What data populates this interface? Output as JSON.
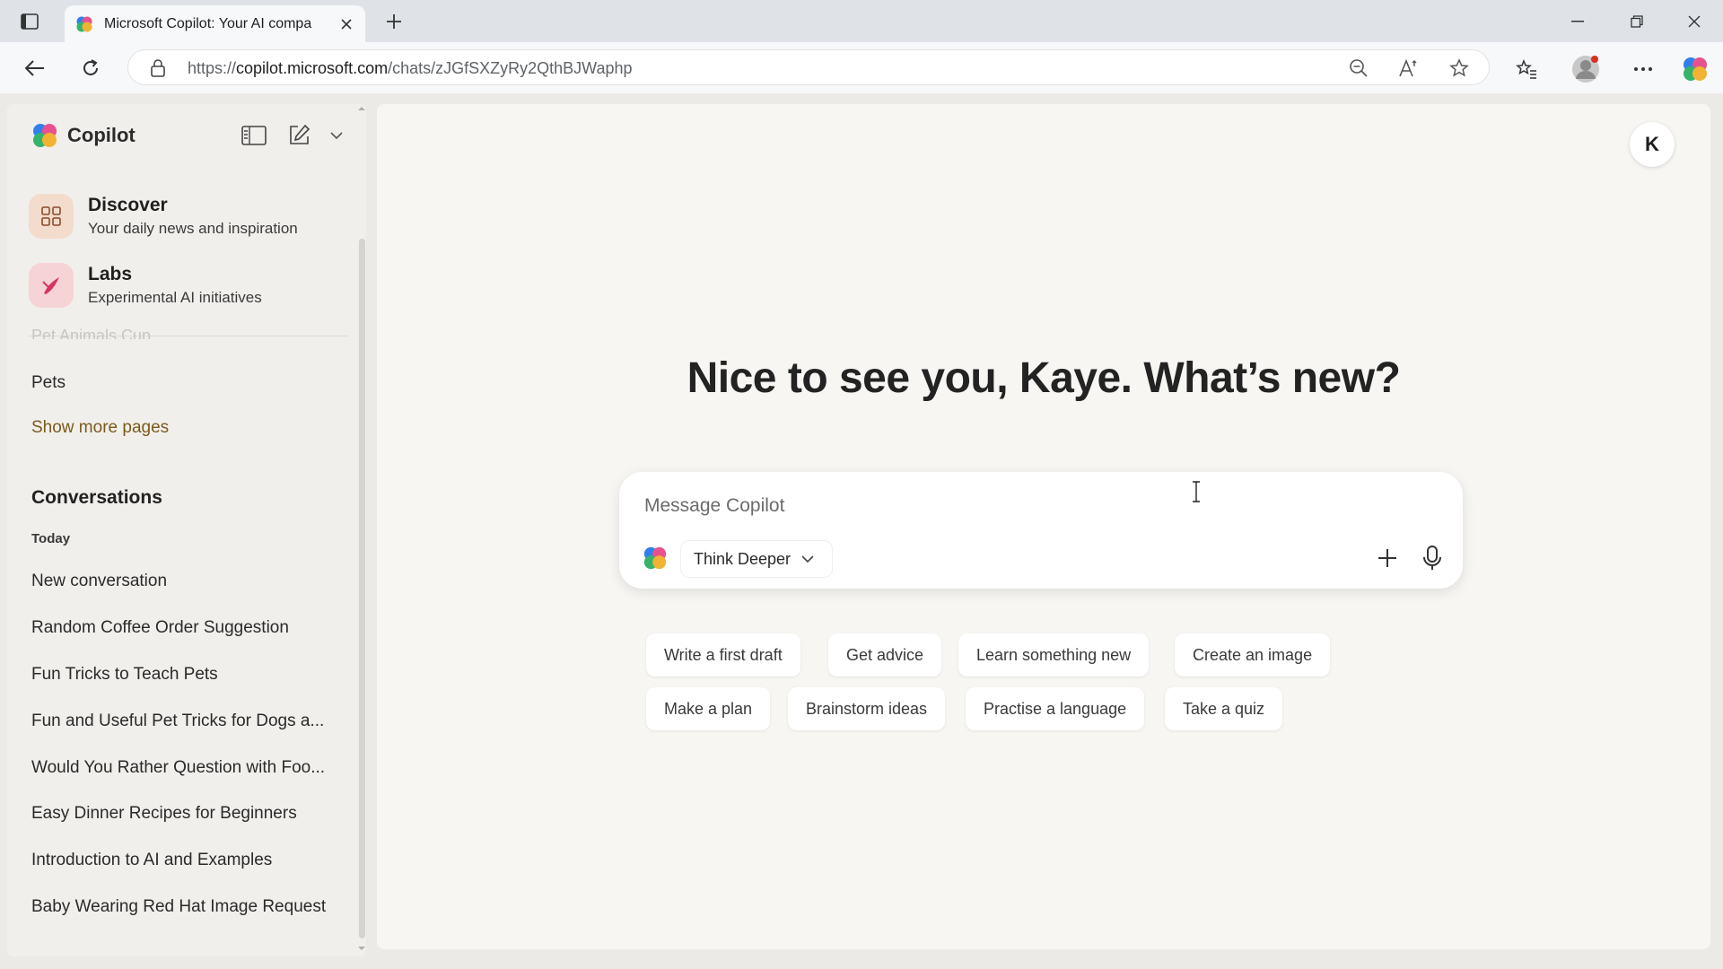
{
  "browser": {
    "tab_title": "Microsoft Copilot: Your AI compa",
    "url_prefix": "https://",
    "url_host": "copilot.microsoft.com",
    "url_path": "/chats/zJGfSXZyRy2QthBJWaphp"
  },
  "sidebar": {
    "brand": "Copilot",
    "features": [
      {
        "title": "Discover",
        "subtitle": "Your daily news and inspiration",
        "icon": "grid-icon"
      },
      {
        "title": "Labs",
        "subtitle": "Experimental AI initiatives",
        "icon": "labs-icon"
      }
    ],
    "faded_item": "Pet Animals Cup",
    "pets": "Pets",
    "show_more": "Show more pages",
    "conversations_heading": "Conversations",
    "today_label": "Today",
    "conversations": [
      "New conversation",
      "Random Coffee Order Suggestion",
      "Fun Tricks to Teach Pets",
      "Fun and Useful Pet Tricks for Dogs a...",
      "Would You Rather Question with Foo...",
      "Easy Dinner Recipes for Beginners",
      "Introduction to AI and Examples",
      "Baby Wearing Red Hat Image Request"
    ]
  },
  "main": {
    "avatar_initial": "K",
    "greeting": "Nice to see you, Kaye. What’s new?",
    "composer": {
      "placeholder": "Message Copilot",
      "mode": "Think Deeper"
    },
    "chips_row1": [
      "Write a first draft",
      "Get advice",
      "Learn something new",
      "Create an image"
    ],
    "chips_row2": [
      "Make a plan",
      "Brainstorm ideas",
      "Practise a language",
      "Take a quiz"
    ]
  },
  "colors": {
    "page_bg": "#eceae7",
    "sidebar_bg": "#f1efec",
    "main_bg": "#f7f6f3",
    "discover_badge": "#f3dccb",
    "labs_badge": "#f6d4d6"
  }
}
